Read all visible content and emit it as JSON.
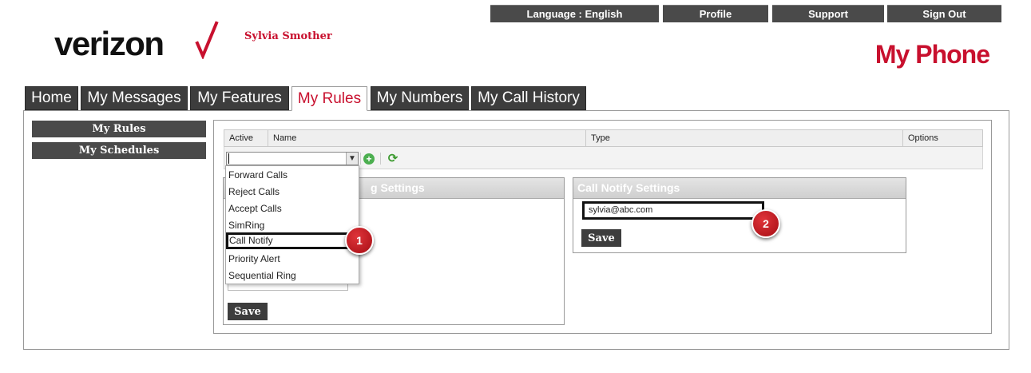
{
  "top_links": [
    "Language : English",
    "Profile",
    "Support",
    "Sign Out"
  ],
  "brand": {
    "logo_text": "verizon",
    "user_name": "Sylvia Smother",
    "title": "My Phone",
    "accent": "#c8102e"
  },
  "tabs": [
    "Home",
    "My Messages",
    "My Features",
    "My Rules",
    "My Numbers",
    "My Call History"
  ],
  "active_tab": "My Rules",
  "sidebar": {
    "items": [
      "My Rules",
      "My Schedules"
    ]
  },
  "grid": {
    "columns": [
      "Active",
      "Name",
      "Type",
      "Options"
    ]
  },
  "rule_type_select": {
    "value": "",
    "options": [
      "Forward Calls",
      "Reject Calls",
      "Accept Calls",
      "SimRing",
      "Call Notify",
      "Priority Alert",
      "Sequential Ring"
    ],
    "highlighted": "Call Notify"
  },
  "left_panel": {
    "title_visible": "g Settings",
    "save_label": "Save"
  },
  "call_notify_panel": {
    "title": "Call Notify Settings",
    "email_value": "sylvia@abc.com",
    "save_label": "Save"
  },
  "markers": [
    "1",
    "2"
  ],
  "icons": {
    "add": "add-circle-icon",
    "refresh": "refresh-icon",
    "dropdown": "chevron-down-icon"
  }
}
